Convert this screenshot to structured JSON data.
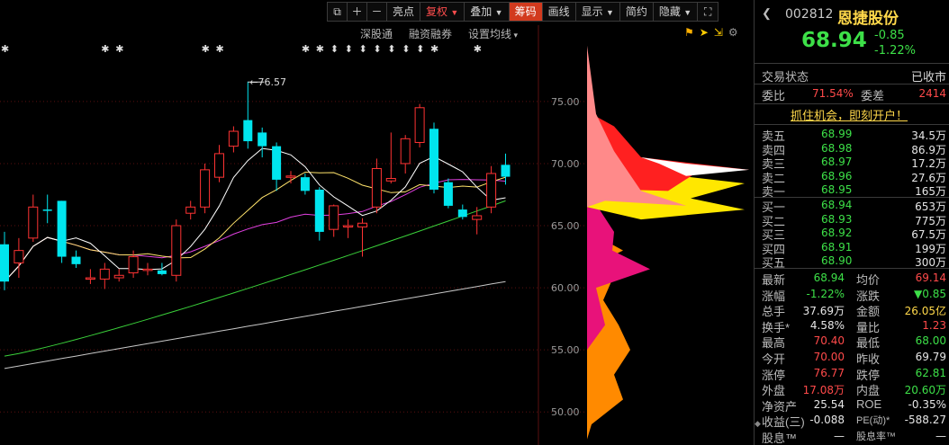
{
  "toolbar": {
    "items": [
      "亮点",
      "复权",
      "叠加",
      "筹码",
      "画线",
      "显示",
      "简约",
      "隐藏"
    ]
  },
  "subtoolbar": {
    "items": [
      "深股通",
      "融资融券",
      "设置均线"
    ]
  },
  "chart_data": {
    "type": "candlestick",
    "price_axis_labels": [
      "75.00",
      "70.00",
      "65.00",
      "60.00",
      "55.00",
      "50.00"
    ],
    "price_axis_values": [
      75,
      70,
      65,
      60,
      55,
      50
    ],
    "ylim": [
      47.7,
      81.0
    ],
    "annotation": "76.57",
    "annotation_value": 76.57,
    "candles": [
      {
        "o": 63.5,
        "h": 64.5,
        "l": 59.8,
        "c": 60.5
      },
      {
        "o": 62.0,
        "h": 64.0,
        "l": 60.8,
        "c": 63.0
      },
      {
        "o": 64.0,
        "h": 67.5,
        "l": 63.7,
        "c": 66.5
      },
      {
        "o": 66.3,
        "h": 67.5,
        "l": 65.2,
        "c": 66.2
      },
      {
        "o": 67.0,
        "h": 67.0,
        "l": 62.0,
        "c": 62.5
      },
      {
        "o": 62.5,
        "h": 63.0,
        "l": 61.6,
        "c": 61.9
      },
      {
        "o": 60.8,
        "h": 61.5,
        "l": 60.3,
        "c": 60.8
      },
      {
        "o": 60.7,
        "h": 62.0,
        "l": 59.9,
        "c": 61.5
      },
      {
        "o": 60.8,
        "h": 61.5,
        "l": 60.5,
        "c": 61.0
      },
      {
        "o": 61.2,
        "h": 63.0,
        "l": 60.8,
        "c": 62.5
      },
      {
        "o": 61.5,
        "h": 62.0,
        "l": 61.0,
        "c": 61.5
      },
      {
        "o": 61.4,
        "h": 62.0,
        "l": 61.0,
        "c": 61.1
      },
      {
        "o": 61.0,
        "h": 65.5,
        "l": 60.5,
        "c": 65.0
      },
      {
        "o": 66.0,
        "h": 67.0,
        "l": 65.5,
        "c": 66.5
      },
      {
        "o": 66.5,
        "h": 70.0,
        "l": 66.0,
        "c": 69.5
      },
      {
        "o": 68.9,
        "h": 71.5,
        "l": 68.5,
        "c": 70.8
      },
      {
        "o": 71.4,
        "h": 73.0,
        "l": 70.9,
        "c": 72.6
      },
      {
        "o": 73.5,
        "h": 76.6,
        "l": 71.2,
        "c": 71.8
      },
      {
        "o": 72.5,
        "h": 72.9,
        "l": 70.5,
        "c": 71.4
      },
      {
        "o": 71.4,
        "h": 71.7,
        "l": 67.8,
        "c": 68.7
      },
      {
        "o": 69.0,
        "h": 69.4,
        "l": 68.4,
        "c": 69.0
      },
      {
        "o": 68.9,
        "h": 69.2,
        "l": 67.5,
        "c": 67.8
      },
      {
        "o": 67.9,
        "h": 68.1,
        "l": 63.8,
        "c": 64.5
      },
      {
        "o": 64.7,
        "h": 66.7,
        "l": 64.1,
        "c": 66.6
      },
      {
        "o": 65.0,
        "h": 65.5,
        "l": 64.0,
        "c": 65.0
      },
      {
        "o": 64.9,
        "h": 65.6,
        "l": 62.5,
        "c": 65.2
      },
      {
        "o": 66.5,
        "h": 70.4,
        "l": 66.0,
        "c": 69.6
      },
      {
        "o": 68.6,
        "h": 72.5,
        "l": 68.4,
        "c": 68.8
      },
      {
        "o": 70.0,
        "h": 72.3,
        "l": 69.2,
        "c": 72.0
      },
      {
        "o": 71.7,
        "h": 74.8,
        "l": 71.3,
        "c": 74.5
      },
      {
        "o": 72.8,
        "h": 73.3,
        "l": 67.6,
        "c": 67.9
      },
      {
        "o": 68.5,
        "h": 68.8,
        "l": 66.4,
        "c": 66.6
      },
      {
        "o": 66.3,
        "h": 66.7,
        "l": 65.5,
        "c": 65.7
      },
      {
        "o": 65.5,
        "h": 66.5,
        "l": 64.3,
        "c": 65.8
      },
      {
        "o": 66.5,
        "h": 69.8,
        "l": 66.0,
        "c": 69.2
      },
      {
        "o": 69.9,
        "h": 70.8,
        "l": 68.3,
        "c": 68.94
      }
    ]
  },
  "quote": {
    "code": "002812",
    "name": "恩捷股份",
    "price": "68.94",
    "change": "-0.85",
    "change_pct": "-1.22%",
    "trade_status_label": "交易状态",
    "trade_status": "已收市",
    "ratio_label": "委比",
    "ratio": "71.54%",
    "diff_label": "委差",
    "diff": "2414",
    "promo": "抓住机会，即刻开户！",
    "asks": [
      {
        "label": "卖五",
        "price": "68.99",
        "vol": "34.5万"
      },
      {
        "label": "卖四",
        "price": "68.98",
        "vol": "86.9万"
      },
      {
        "label": "卖三",
        "price": "68.97",
        "vol": "17.2万"
      },
      {
        "label": "卖二",
        "price": "68.96",
        "vol": "27.6万"
      },
      {
        "label": "卖一",
        "price": "68.95",
        "vol": "165万"
      }
    ],
    "bids": [
      {
        "label": "买一",
        "price": "68.94",
        "vol": "653万"
      },
      {
        "label": "买二",
        "price": "68.93",
        "vol": "775万"
      },
      {
        "label": "买三",
        "price": "68.92",
        "vol": "67.5万"
      },
      {
        "label": "买四",
        "price": "68.91",
        "vol": "199万"
      },
      {
        "label": "买五",
        "price": "68.90",
        "vol": "300万"
      }
    ],
    "stats": [
      {
        "l1": "最新",
        "v1": "68.94",
        "c1": "g",
        "l2": "均价",
        "v2": "69.14",
        "c2": "r"
      },
      {
        "l1": "涨幅",
        "v1": "-1.22%",
        "c1": "g",
        "l2": "涨跌",
        "v2": "▼0.85",
        "c2": "g"
      },
      {
        "l1": "总手",
        "v1": "37.69万",
        "c1": "w",
        "l2": "金额",
        "v2": "26.05亿",
        "c2": "y"
      },
      {
        "l1": "换手*",
        "v1": "4.58%",
        "c1": "w",
        "l2": "量比",
        "v2": "1.23",
        "c2": "r"
      },
      {
        "l1": "最高",
        "v1": "70.40",
        "c1": "r",
        "l2": "最低",
        "v2": "68.00",
        "c2": "g"
      },
      {
        "l1": "今开",
        "v1": "70.00",
        "c1": "r",
        "l2": "昨收",
        "v2": "69.79",
        "c2": "w"
      },
      {
        "l1": "涨停",
        "v1": "76.77",
        "c1": "r",
        "l2": "跌停",
        "v2": "62.81",
        "c2": "g"
      },
      {
        "l1": "外盘",
        "v1": "17.08万",
        "c1": "r",
        "l2": "内盘",
        "v2": "20.60万",
        "c2": "g"
      },
      {
        "l1": "净资产",
        "v1": "25.54",
        "c1": "w",
        "l2": "ROE",
        "v2": "-0.35%",
        "c2": "w"
      },
      {
        "l1": "收益(三)",
        "v1": "-0.088",
        "c1": "w",
        "l2": "PE(动)*",
        "v2": "-588.27",
        "c2": "w"
      },
      {
        "l1": "股息™",
        "v1": "—",
        "c1": "w",
        "l2": "股息率™",
        "v2": "—",
        "c2": "w"
      }
    ]
  },
  "colors": {
    "up": "#ff3333",
    "down": "#00e5ee",
    "ma5": "#ffffff",
    "ma10": "#ffe36b",
    "ma20": "#e040e0",
    "ma60": "#3ad13a",
    "ma120": "#c8c8c8"
  }
}
